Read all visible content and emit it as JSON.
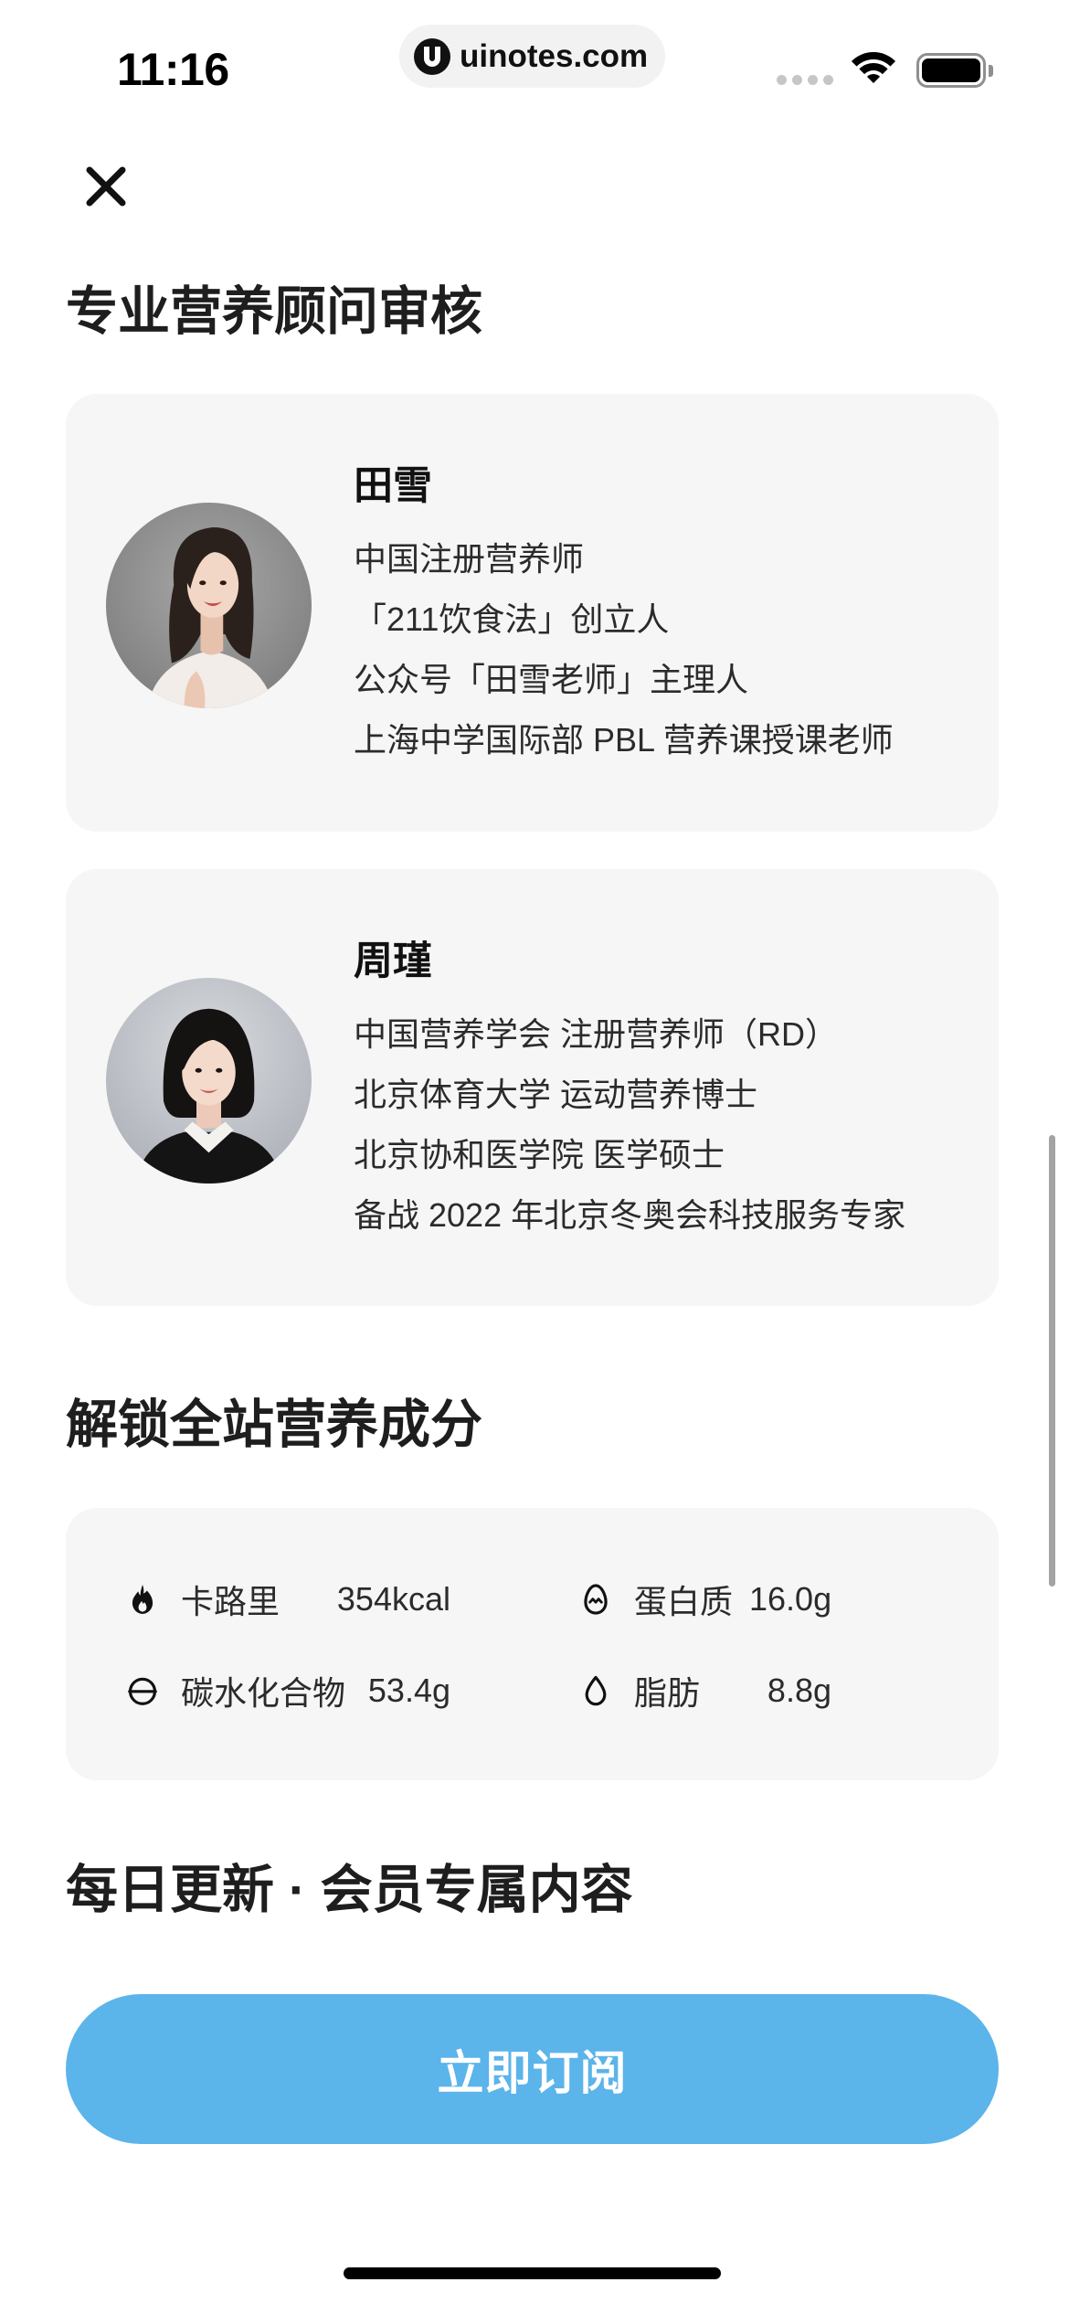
{
  "status_bar": {
    "time": "11:16",
    "url": "uinotes.com",
    "logo_icon": "uinotes-logo-icon",
    "icons": [
      "cellular-signal-icon",
      "wifi-icon",
      "battery-icon"
    ],
    "battery_level": 1
  },
  "toolbar": {
    "close_icon": "close-icon"
  },
  "reviewers": {
    "title": "专业营养顾问审核",
    "people": [
      {
        "name": "田雪",
        "lines": [
          "中国注册营养师",
          "「211饮食法」创立人",
          "公众号「田雪老师」主理人",
          "上海中学国际部 PBL 营养课授课老师"
        ]
      },
      {
        "name": "周瑾",
        "lines": [
          "中国营养学会 注册营养师（RD）",
          "北京体育大学 运动营养博士",
          "北京协和医学院 医学硕士",
          "备战 2022 年北京冬奥会科技服务专家"
        ]
      }
    ]
  },
  "nutrition": {
    "title": "解锁全站营养成分",
    "items": [
      {
        "icon": "flame-icon",
        "label": "卡路里",
        "value": "354kcal"
      },
      {
        "icon": "egg-icon",
        "label": "蛋白质",
        "value": "16.0g"
      },
      {
        "icon": "carbs-icon",
        "label": "碳水化合物",
        "value": "53.4g"
      },
      {
        "icon": "drop-icon",
        "label": "脂肪",
        "value": "8.8g"
      }
    ]
  },
  "daily": {
    "title": "每日更新 · 会员专属内容"
  },
  "subscribe_button": {
    "label": "立即订阅"
  },
  "theme": {
    "accent": "#5bb4ea",
    "card": "#f6f6f6",
    "text": "#1e1e1e",
    "button_text": "#ffffff"
  }
}
